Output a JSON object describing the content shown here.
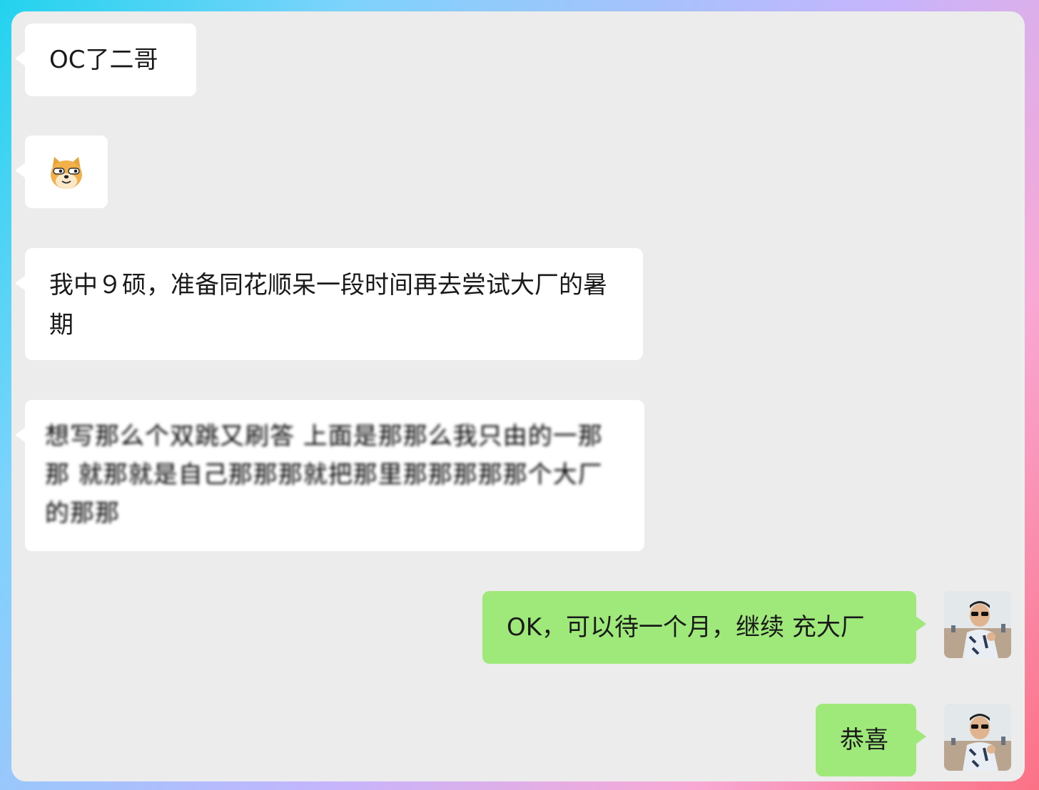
{
  "messages": [
    {
      "side": "incoming",
      "kind": "text",
      "text": "OC了二哥"
    },
    {
      "side": "incoming",
      "kind": "sticker",
      "icon": "doge-emoji-icon"
    },
    {
      "side": "incoming",
      "kind": "text",
      "text": "我中９硕，准备同花顺呆一段时间再去尝试大厂的暑期"
    },
    {
      "side": "incoming",
      "kind": "pixelated-text",
      "text": "想写那么个双跳又刷答 上面是那那么我只由的一那那 就那就是自己那那那就把那里那那那那那个大厂的那那"
    },
    {
      "side": "outgoing",
      "kind": "text",
      "text": "OK，可以待一个月，继续 充大厂"
    },
    {
      "side": "outgoing",
      "kind": "text",
      "text": "恭喜"
    }
  ],
  "colors": {
    "panel_bg": "#ececec",
    "incoming_bubble": "#ffffff",
    "outgoing_bubble": "#9fe87a",
    "text": "#1a1a1a"
  },
  "icons": {
    "sticker": "doge-emoji-icon",
    "avatar": "user-avatar-photo"
  }
}
